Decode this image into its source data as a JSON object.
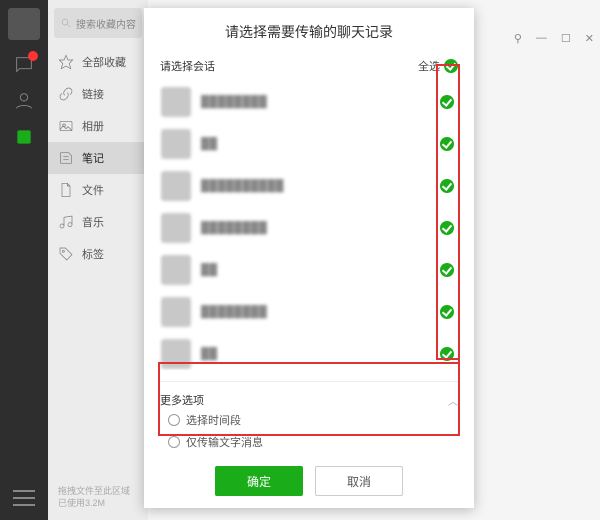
{
  "rail": {
    "items": [
      "chat",
      "contacts",
      "favorites"
    ],
    "selected": "favorites"
  },
  "bgwin": {
    "pin": "⚲",
    "min": "—",
    "max": "☐",
    "close": "✕"
  },
  "side": {
    "search_placeholder": "搜索收藏内容",
    "items": [
      {
        "icon": "star",
        "label": "全部收藏"
      },
      {
        "icon": "link",
        "label": "链接"
      },
      {
        "icon": "image",
        "label": "相册"
      },
      {
        "icon": "note",
        "label": "笔记",
        "selected": true
      },
      {
        "icon": "file",
        "label": "文件"
      },
      {
        "icon": "music",
        "label": "音乐"
      },
      {
        "icon": "tag",
        "label": "标签"
      }
    ],
    "footer_line1": "拖拽文件至此区域",
    "footer_line2": "已使用3.2M"
  },
  "modal": {
    "title": "请选择需要传输的聊天记录",
    "select_label": "请选择会话",
    "select_all": "全选",
    "conversations": [
      {
        "name": "████████"
      },
      {
        "name": "██"
      },
      {
        "name": "██████████"
      },
      {
        "name": "████████"
      },
      {
        "name": "██"
      },
      {
        "name": "████████"
      },
      {
        "name": "██"
      }
    ],
    "more_label": "更多选项",
    "opt_time": "选择时间段",
    "opt_text_only": "仅传输文字消息",
    "ok": "确定",
    "cancel": "取消"
  }
}
